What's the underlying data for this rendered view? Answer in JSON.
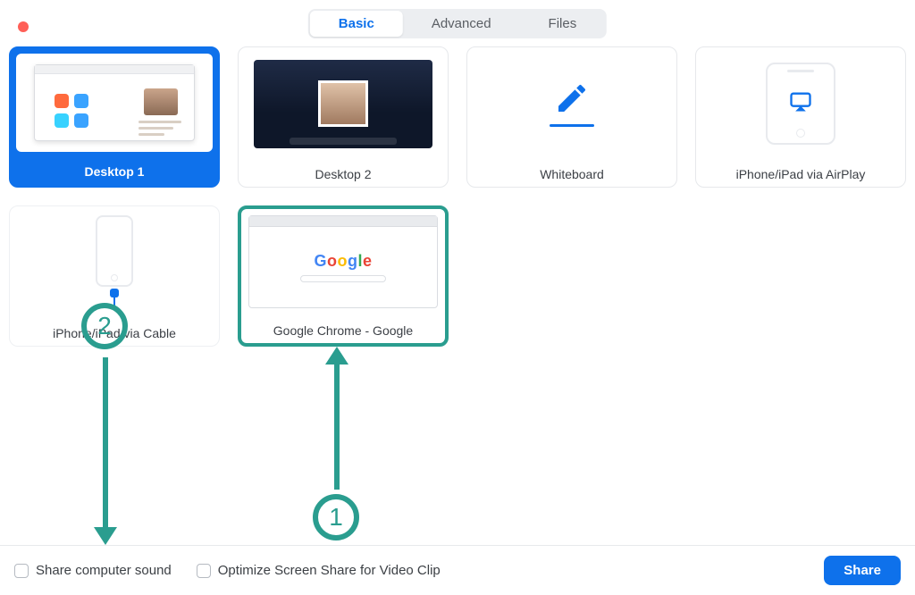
{
  "tabs": {
    "basic": "Basic",
    "advanced": "Advanced",
    "files": "Files",
    "active": "basic"
  },
  "tiles": {
    "desktop1": "Desktop 1",
    "desktop2": "Desktop 2",
    "whiteboard": "Whiteboard",
    "airplay": "iPhone/iPad via AirPlay",
    "cable": "iPhone/iPad via Cable",
    "chrome": "Google Chrome - Google"
  },
  "google_letters": [
    "G",
    "o",
    "o",
    "g",
    "l",
    "e"
  ],
  "footer": {
    "share_sound": "Share computer sound",
    "optimize": "Optimize Screen Share for Video Clip",
    "share_btn": "Share"
  },
  "annotations": {
    "one": "1",
    "two": "2"
  }
}
